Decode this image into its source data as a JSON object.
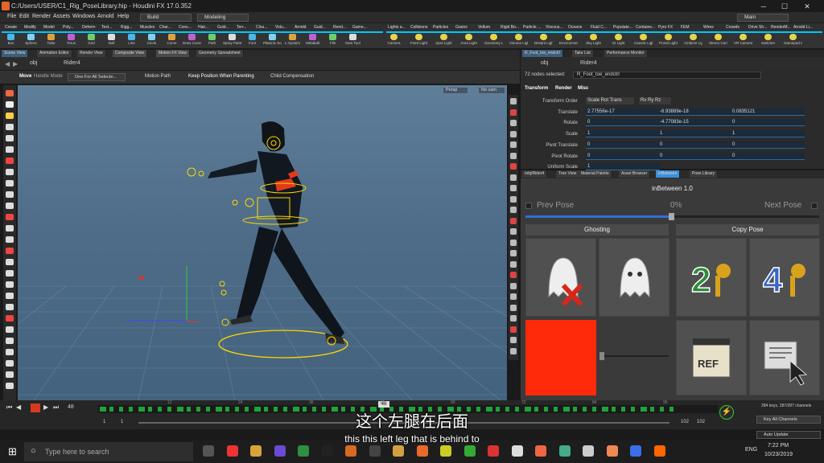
{
  "window": {
    "title": "C:/Users/USER/C1_Rig_PoseLibrary.hip - Houdini FX 17.0.352"
  },
  "menu": {
    "items": [
      "File",
      "Edit",
      "Render",
      "Assets",
      "Windows",
      "Arnold",
      "Help"
    ],
    "build": "Build",
    "desktop": "Modeling",
    "main": "Main"
  },
  "shelf_tabs_left": [
    "Create",
    "Modify",
    "Model",
    "Poly...",
    "Deform",
    "Text...",
    "Rigg...",
    "Muscles",
    "Char...",
    "Cons...",
    "Hair...",
    "Guid...",
    "Terr...",
    "Clou...",
    "Volu...",
    "Arnold",
    "Guid...",
    "Rend...",
    "Game..."
  ],
  "shelf_tabs_right": [
    "Lights a...",
    "Collisions",
    "Particles",
    "Grains",
    "Vellum",
    "Rigid Bo...",
    "Particle ...",
    "Viscous...",
    "Oceans",
    "Fluid C...",
    "Populate...",
    "Containe...",
    "Pyro FX",
    "FEM",
    "Wires",
    "Crowds",
    "Drive Sh...",
    "RenderM...",
    "Arnold Li..."
  ],
  "shelf_tools_left": [
    "Box",
    "Sphere",
    "Tube",
    "Torus",
    "Grid",
    "Null",
    "Line",
    "Circle",
    "Curve",
    "Draw Curve",
    "Path",
    "Spray Paint",
    "Font",
    "Platonic Solids",
    "L-System",
    "Metaball",
    "File",
    "New Tool"
  ],
  "shelf_tools_right": [
    "Camera",
    "Point Light",
    "Spot Light",
    "Area Light",
    "Geometry Light",
    "Volume Light",
    "Distant Light",
    "Environment Light",
    "Sky Light",
    "GI Light",
    "Caustic Light",
    "Portal Light",
    "Ambient Light",
    "Stereo Camera",
    "VR Camera",
    "Switcher",
    "Gamepad Camera"
  ],
  "pane_tabs": [
    "Scene View",
    "Animation Editor",
    "Render View",
    "Composite View",
    "Motion FX View",
    "Geometry Spreadsheet"
  ],
  "viewer": {
    "path_obj": "obj",
    "path_node": "Rider4",
    "tool": "Move",
    "handle_mode": "Handle Mode",
    "handle_dd": "One For All Selecte...",
    "motion_path": "Motion Path",
    "keep_pos": "Keep Position When Parenting",
    "child_comp": "Child Compensation",
    "persp": "Persp",
    "cam": "No cam"
  },
  "params": {
    "tabs": [
      "R_Foot_toe_endctrl",
      "Take List",
      "Performance Monitor"
    ],
    "path_obj": "obj",
    "path_node": "Rider4",
    "nodes_selected": "72 nodes selected:",
    "node_name": "R_Foot_toe_endctrl",
    "subtabs": [
      "Transform",
      "Render",
      "Misc"
    ],
    "rows": [
      {
        "label": "Transform Order",
        "v": [
          "Scale Rot Trans",
          "Rx Ry Rz"
        ]
      },
      {
        "label": "Translate",
        "v": [
          "2.77556e-17",
          "-6.93889e-18",
          "0.0835121"
        ]
      },
      {
        "label": "Rotate",
        "v": [
          "0",
          "-4.77083e-15",
          "0"
        ]
      },
      {
        "label": "Scale",
        "v": [
          "1",
          "1",
          "1"
        ]
      },
      {
        "label": "Pivot Translate",
        "v": [
          "0",
          "0",
          "0"
        ]
      },
      {
        "label": "Pivot Rotate",
        "v": [
          "0",
          "0",
          "0"
        ]
      },
      {
        "label": "Uniform Scale",
        "v": [
          "1"
        ]
      }
    ]
  },
  "inbetween": {
    "tabs": [
      "/obj/Rider4",
      "Tree View",
      "Material Palette",
      "Asset Browser",
      "inBetween",
      "Pose Library"
    ],
    "title": "inBetween 1.0",
    "prev": "Prev Pose",
    "next": "Next Pose",
    "percent": "0%",
    "ghosting": "Ghosting",
    "copy_pose": "Copy Pose",
    "swatch": "#ff2a0a"
  },
  "timeline": {
    "frame": "48",
    "marker": "48",
    "ticks": [
      "12",
      "24",
      "36",
      "48",
      "60",
      "72",
      "84",
      "96"
    ],
    "start": "1",
    "start2": "1",
    "end": "102",
    "end2": "102",
    "keys_info": "284 keys, 287/287 channels",
    "key_channels": "Key All Channels",
    "auto_update": "Auto Update"
  },
  "taskbar": {
    "search": "Type here to search",
    "time": "7:22 PM",
    "date": "10/23/2019",
    "lang": "ENG"
  },
  "subtitle": {
    "zh": "这个左腿在后面",
    "en": "this this left leg that is behind to"
  }
}
